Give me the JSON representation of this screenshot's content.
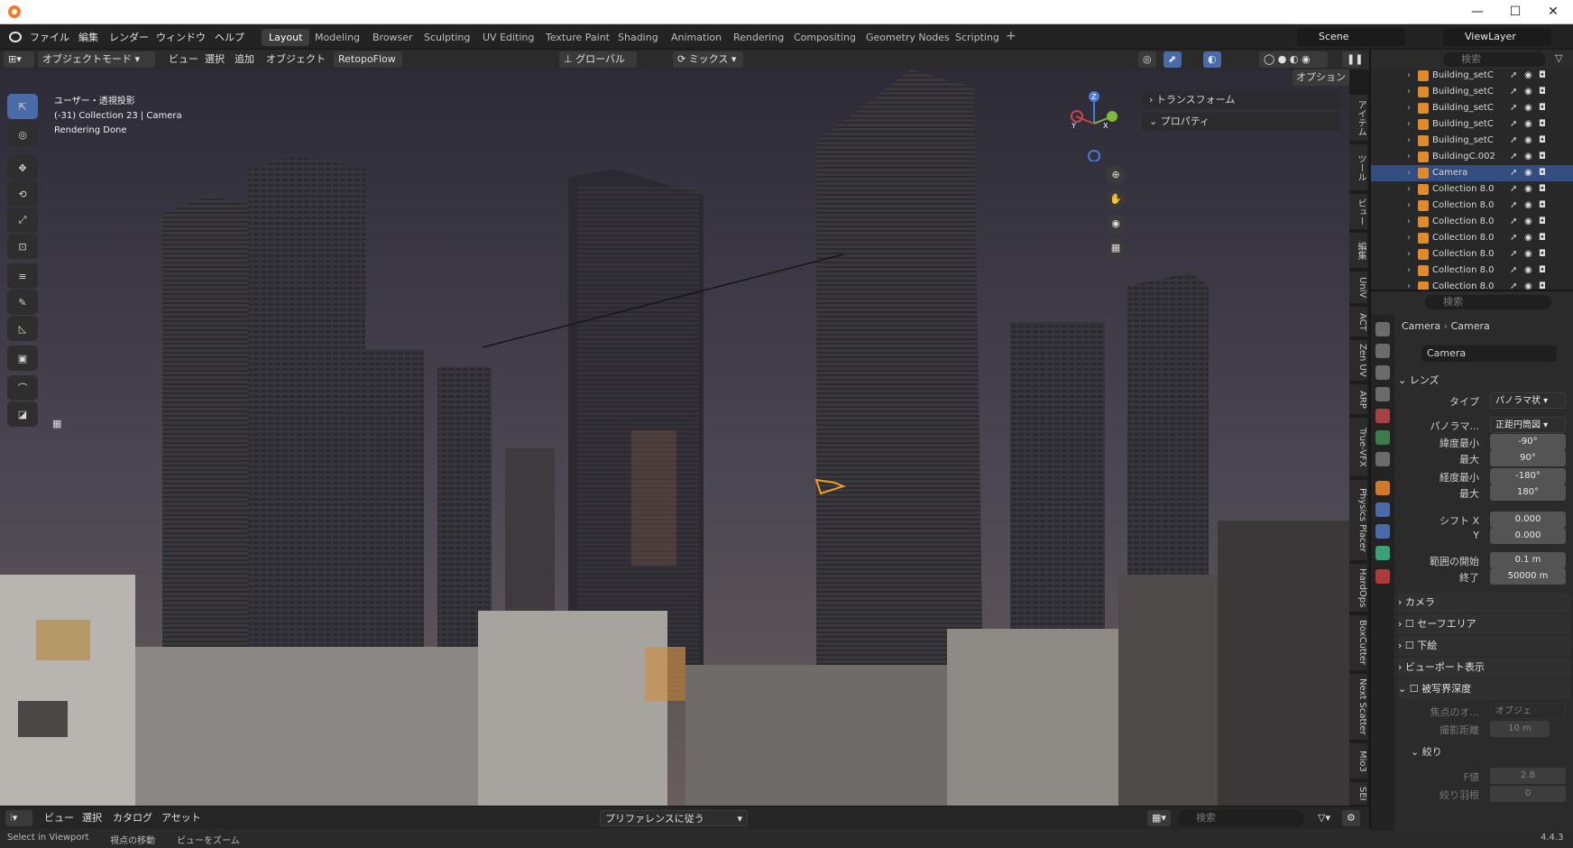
{
  "window": {
    "title_icon": "blender-logo",
    "controls": [
      "—",
      "☐",
      "✕"
    ]
  },
  "menu": [
    "ファイル",
    "編集",
    "レンダー",
    "ウィンドウ",
    "ヘルプ"
  ],
  "workspaces": [
    "Layout",
    "Modeling",
    "Browser",
    "Sculpting",
    "UV Editing",
    "Texture Paint",
    "Shading",
    "Animation",
    "Rendering",
    "Compositing",
    "Geometry Nodes",
    "Scripting"
  ],
  "active_workspace": "Layout",
  "scene": {
    "name": "Scene",
    "viewlayer": "ViewLayer"
  },
  "viewport_header": {
    "mode": "オブジェクトモード",
    "menus": [
      "ビュー",
      "選択",
      "追加",
      "オブジェクト"
    ],
    "addon": "RetopoFlow",
    "transform": "グローバル",
    "snap": "ミックス",
    "options": "オプション"
  },
  "overlay_text": {
    "view": "ユーザー・透視投影",
    "context": "(-31) Collection 23 | Camera",
    "status": "Rendering Done"
  },
  "n_panel": {
    "sections": [
      "トランスフォーム",
      "プロパティ"
    ]
  },
  "side_tabs": [
    "アイテム",
    "ツール",
    "ビュー",
    "編集",
    "UniV",
    "ACT",
    "Zen UV",
    "ARP",
    "True-VFX",
    "Physics Placer",
    "HardOps",
    "BoxCutter",
    "Next Scatter",
    "Mio3",
    "SEI"
  ],
  "gizmo": {
    "x": "X",
    "y": "Y",
    "z": "Z"
  },
  "outliner": {
    "search_placeholder": "検索",
    "rows": [
      "Building_setC",
      "Building_setC",
      "Building_setC",
      "Building_setC",
      "Building_setC",
      "BuildingC.002",
      "Camera",
      "Collection 8.0",
      "Collection 8.0",
      "Collection 8.0",
      "Collection 8.0",
      "Collection 8.0",
      "Collection 8.0",
      "Collection 8.0"
    ],
    "selected_index": 6
  },
  "properties": {
    "search_placeholder": "検索",
    "breadcrumb": [
      "Camera",
      "Camera"
    ],
    "data_name": "Camera",
    "lens_title": "レンズ",
    "type_label": "タイプ",
    "type_value": "パノラマ状",
    "panorama_label": "パノラマ...",
    "panorama_value": "正距円筒図",
    "lat_min_label": "緯度最小",
    "lat_min": "-90°",
    "lat_max_label": "最大",
    "lat_max": "90°",
    "lon_min_label": "経度最小",
    "lon_min": "-180°",
    "lon_max_label": "最大",
    "lon_max": "180°",
    "shift_x_label": "シフト X",
    "shift_x": "0.000",
    "shift_y_label": "Y",
    "shift_y": "0.000",
    "clip_start_label": "範囲の開始",
    "clip_start": "0.1 m",
    "clip_end_label": "終了",
    "clip_end": "50000 m",
    "sections": [
      "カメラ",
      "セーフエリア",
      "下絵",
      "ビューポート表示",
      "被写界深度"
    ],
    "focus_obj_label": "焦点のオ...",
    "focus_obj_placeholder": "オブジェ",
    "focus_dist_label": "撮影距離",
    "focus_dist": "10 m",
    "aperture_title": "絞り",
    "fstop_label": "F値",
    "fstop": "2.8",
    "blades_label": "絞り羽根",
    "blades": "0"
  },
  "bottom_header": {
    "menus": [
      "ビュー",
      "選択",
      "カタログ",
      "アセット"
    ],
    "preference": "プリファレンスに従う",
    "search_placeholder": "検索"
  },
  "statusbar": {
    "items": [
      "Select in Viewport",
      "視点の移動",
      "ビューをズーム"
    ],
    "version": "4.4.3"
  }
}
